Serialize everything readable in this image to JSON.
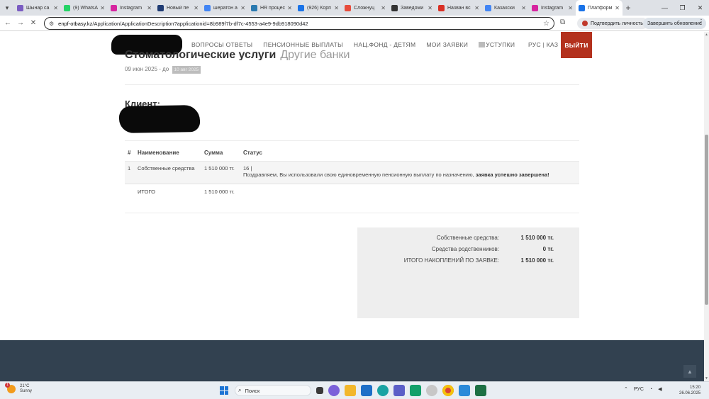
{
  "browser": {
    "tabs": [
      {
        "title": "Шынар са",
        "color": "#7a5cc2",
        "icon": "user-icon"
      },
      {
        "title": "(9) WhatsA",
        "color": "#25d366",
        "icon": "whatsapp-icon"
      },
      {
        "title": "Instagram",
        "color": "#d6249f",
        "icon": "instagram-icon"
      },
      {
        "title": "Новый пе",
        "color": "#1f3b73",
        "icon": "document-icon"
      },
      {
        "title": "шератон а",
        "color": "#4285f4",
        "icon": "google-icon"
      },
      {
        "title": "HR процес",
        "color": "#2a7ab0",
        "icon": "hr-icon"
      },
      {
        "title": "(926) Корп",
        "color": "#1a73e8",
        "icon": "globe-icon"
      },
      {
        "title": "Сложнуц",
        "color": "#e74c3c",
        "icon": "chart-icon"
      },
      {
        "title": "Заведоми",
        "color": "#333333",
        "icon": "circle-icon"
      },
      {
        "title": "Назван вс",
        "color": "#d93025",
        "icon": "flag-icon"
      },
      {
        "title": "Казахски",
        "color": "#4285f4",
        "icon": "google-icon"
      },
      {
        "title": "Instagram",
        "color": "#d6249f",
        "icon": "instagram-icon"
      },
      {
        "title": "Платформ",
        "color": "#1a73e8",
        "icon": "platform-icon",
        "active": true
      }
    ],
    "url_host": "enpf-otbasy.kz",
    "url_path": "/Application/ApplicationDescription?applicationid=8b989f7b-df7c-4553-a4e9-9db918090d42",
    "verify_label": "Подтвердить личность",
    "update_label": "Завершить обновление"
  },
  "site": {
    "nav": [
      "ВОПРОСЫ ОТВЕТЫ",
      "ПЕНСИОННЫЕ ВЫПЛАТЫ",
      "НАЦ.ФОНД - ДЕТЯМ",
      "МОИ ЗАЯВКИ",
      "УСТУПКИ"
    ],
    "lang": "РУС | КАЗ",
    "logout": "ВЫЙТИ"
  },
  "application": {
    "title": "Стоматологические услуги",
    "subtitle": "Другие банки",
    "date_prefix": "09 июн 2025 - до",
    "date_badge": "10 авг 2025",
    "client_label": "Клиент:"
  },
  "table": {
    "headers": [
      "#",
      "Наименование",
      "Сумма",
      "Статус"
    ],
    "rows": [
      {
        "num": "1",
        "name": "Собственные средства",
        "amount": "1 510 000 тг.",
        "status_code": "16 |",
        "status_msg": "Поздравляем, Вы использовали свою единовременную пенсионную выплату по назначению,",
        "status_bold": "заявка успешно завершена!"
      }
    ],
    "total_label": "ИТОГО",
    "total_amount": "1 510 000 тг."
  },
  "summary": [
    {
      "label": "Собственные средства:",
      "value": "1 510 000 тг."
    },
    {
      "label": "Средства родственников:",
      "value": "0 тг."
    },
    {
      "label": "ИТОГО НАКОПЛЕНИЙ ПО ЗАЯВКЕ:",
      "value": "1 510 000 тг."
    }
  ],
  "taskbar": {
    "weather_temp": "21°C",
    "weather_desc": "Sunny",
    "weather_badge": "1",
    "search_placeholder": "Поиск",
    "lang": "РУС",
    "time": "15:20",
    "date": "26.06.2025"
  }
}
